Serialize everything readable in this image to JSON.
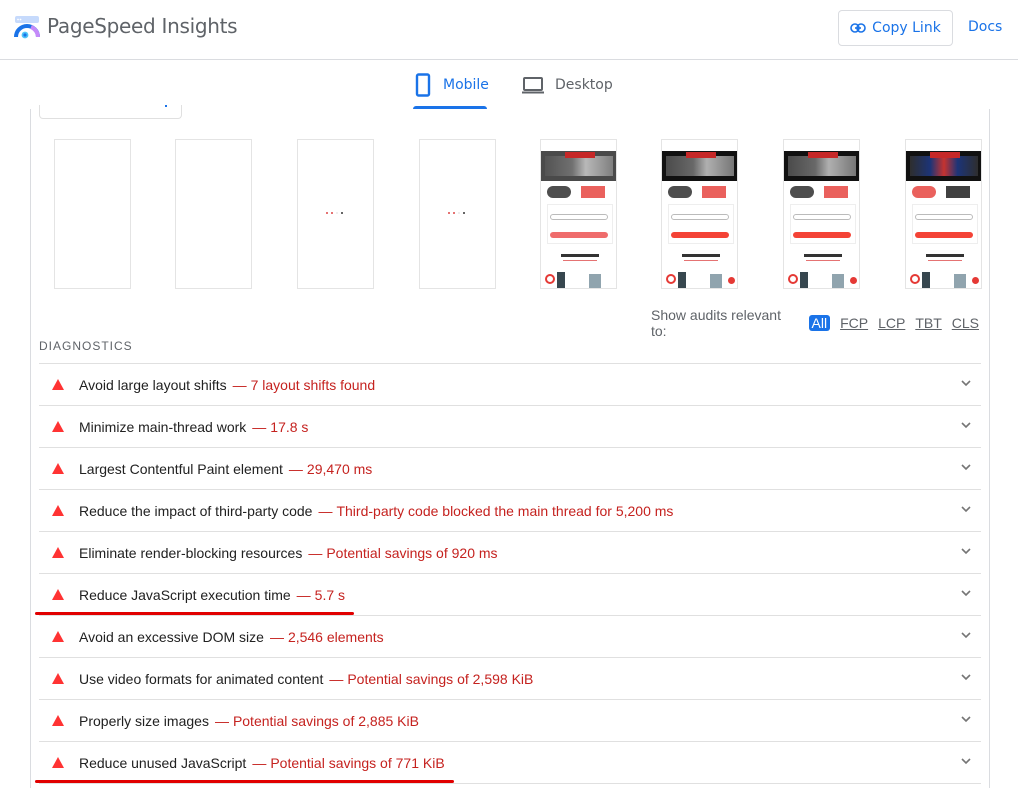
{
  "header": {
    "app_title": "PageSpeed Insights",
    "copy_link_label": "Copy Link",
    "docs_label": "Docs"
  },
  "tabs": [
    {
      "label": "Mobile",
      "active": true,
      "icon": "phone-icon"
    },
    {
      "label": "Desktop",
      "active": false,
      "icon": "laptop-icon"
    }
  ],
  "filmstrip": {
    "frames": [
      {
        "state": "blank"
      },
      {
        "state": "blank"
      },
      {
        "state": "loading-dots"
      },
      {
        "state": "loading-dots"
      },
      {
        "state": "page-rendered"
      },
      {
        "state": "page-rendered"
      },
      {
        "state": "page-rendered"
      },
      {
        "state": "page-rendered"
      }
    ]
  },
  "filter": {
    "label": "Show audits relevant to:",
    "options": [
      "All",
      "FCP",
      "LCP",
      "TBT",
      "CLS"
    ],
    "selected": "All"
  },
  "diagnostics": {
    "section_title": "DIAGNOSTICS",
    "separator": "—",
    "items": [
      {
        "title": "Avoid large layout shifts",
        "detail": "7 layout shifts found",
        "severity": "fail",
        "highlighted": false
      },
      {
        "title": "Minimize main-thread work",
        "detail": "17.8 s",
        "severity": "fail",
        "highlighted": false
      },
      {
        "title": "Largest Contentful Paint element",
        "detail": "29,470 ms",
        "severity": "fail",
        "highlighted": false
      },
      {
        "title": "Reduce the impact of third-party code",
        "detail": "Third-party code blocked the main thread for 5,200 ms",
        "severity": "fail",
        "highlighted": false
      },
      {
        "title": "Eliminate render-blocking resources",
        "detail": "Potential savings of 920 ms",
        "severity": "fail",
        "highlighted": false
      },
      {
        "title": "Reduce JavaScript execution time",
        "detail": "5.7 s",
        "severity": "fail",
        "highlighted": true
      },
      {
        "title": "Avoid an excessive DOM size",
        "detail": "2,546 elements",
        "severity": "fail",
        "highlighted": false
      },
      {
        "title": "Use video formats for animated content",
        "detail": "Potential savings of 2,598 KiB",
        "severity": "fail",
        "highlighted": false
      },
      {
        "title": "Properly size images",
        "detail": "Potential savings of 2,885 KiB",
        "severity": "fail",
        "highlighted": false
      },
      {
        "title": "Reduce unused JavaScript",
        "detail": "Potential savings of 771 KiB",
        "severity": "fail",
        "highlighted": true
      }
    ]
  },
  "colors": {
    "accent": "#1a73e8",
    "fail": "#ff3333",
    "fail_text": "#c5221f",
    "annotation": "#e10000"
  }
}
